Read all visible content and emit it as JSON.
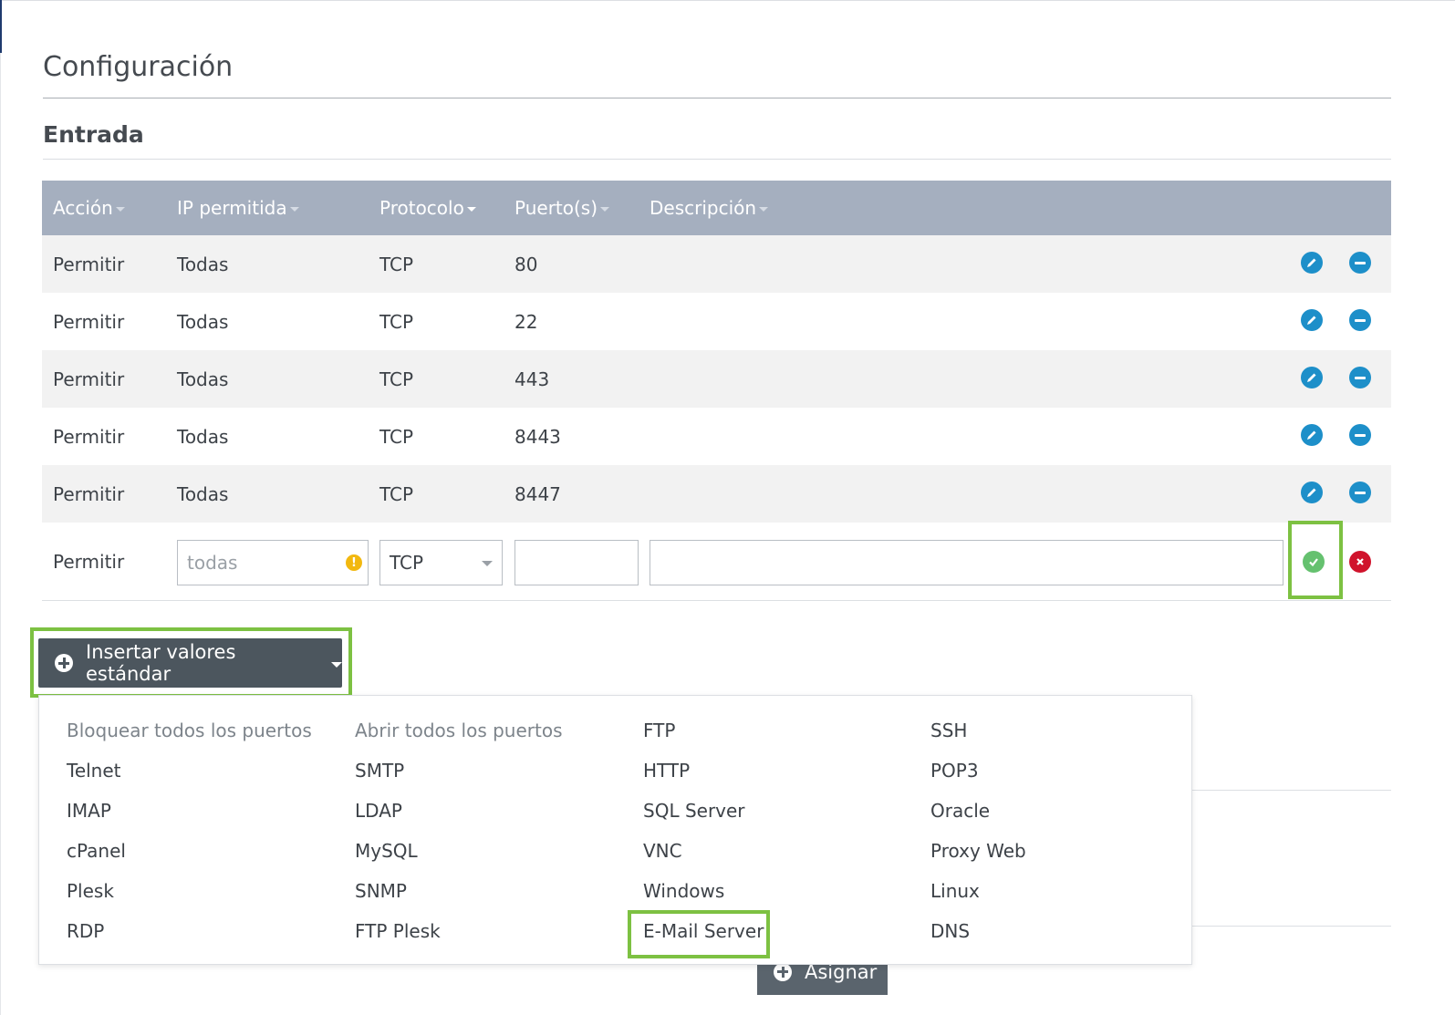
{
  "page": {
    "title": "Configuración",
    "section": "Entrada"
  },
  "table": {
    "columns": [
      "Acción",
      "IP permitida",
      "Protocolo",
      "Puerto(s)",
      "Descripción"
    ],
    "rows": [
      {
        "action": "Permitir",
        "ip": "Todas",
        "protocol": "TCP",
        "ports": "80",
        "description": ""
      },
      {
        "action": "Permitir",
        "ip": "Todas",
        "protocol": "TCP",
        "ports": "22",
        "description": ""
      },
      {
        "action": "Permitir",
        "ip": "Todas",
        "protocol": "TCP",
        "ports": "443",
        "description": ""
      },
      {
        "action": "Permitir",
        "ip": "Todas",
        "protocol": "TCP",
        "ports": "8443",
        "description": ""
      },
      {
        "action": "Permitir",
        "ip": "Todas",
        "protocol": "TCP",
        "ports": "8447",
        "description": ""
      }
    ],
    "edit_row": {
      "action": "Permitir",
      "ip_placeholder": "todas",
      "protocol_value": "TCP",
      "ports_value": "",
      "description_value": ""
    }
  },
  "standard_values": {
    "button_label": "Insertar valores estándar",
    "items": [
      [
        "Bloquear todos los puertos",
        "Abrir todos los puertos",
        "FTP",
        "SSH"
      ],
      [
        "Telnet",
        "SMTP",
        "HTTP",
        "POP3"
      ],
      [
        "IMAP",
        "LDAP",
        "SQL Server",
        "Oracle"
      ],
      [
        "cPanel",
        "MySQL",
        "VNC",
        "Proxy Web"
      ],
      [
        "Plesk",
        "SNMP",
        "Windows",
        "Linux"
      ],
      [
        "RDP",
        "FTP Plesk",
        "E-Mail Server",
        "DNS"
      ]
    ]
  },
  "assign_button": {
    "label": "Asignar"
  },
  "colors": {
    "header_bg": "#a5afbf",
    "action_blue": "#1d8fc9",
    "confirm_green": "#65c16f",
    "cancel_red": "#d0132c",
    "highlight_green": "#7dc142",
    "button_dark": "#4c565e"
  }
}
